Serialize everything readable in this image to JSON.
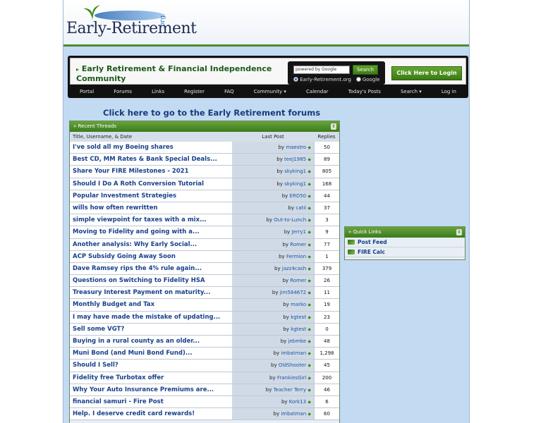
{
  "header": {
    "logo_text": "Early-Retirement",
    "logo_suffix": ".org"
  },
  "site": {
    "title": "Early Retirement & Financial Independence Community",
    "title_arrow": "▸"
  },
  "search": {
    "placeholder": "powered by Google",
    "button_label": "Search",
    "option_site": "Early-Retirement.org",
    "option_google": "Google"
  },
  "login": {
    "label": "Click Here to Login"
  },
  "nav": {
    "items": [
      {
        "label": "Portal"
      },
      {
        "label": "Forums"
      },
      {
        "label": "Links"
      },
      {
        "label": "Register"
      },
      {
        "label": "FAQ"
      },
      {
        "label": "Community ▾"
      },
      {
        "label": "Calendar"
      },
      {
        "label": "Today's Posts"
      },
      {
        "label": "Search ▾"
      },
      {
        "label": "Log in"
      }
    ]
  },
  "forums_link": "Click here to go to the Early Retirement forums",
  "recent_threads": {
    "heading": "» Recent Threads",
    "toggle": "⇕",
    "col_title": "Title, Username, & Date",
    "col_last": "Last Post",
    "col_replies": "Replies",
    "by": "by",
    "rows": [
      {
        "title": "I've sold all my Boeing shares",
        "user": "maestro",
        "replies": "50"
      },
      {
        "title": "Best CD, MM Rates & Bank Special Deals...",
        "user": "teej1985",
        "replies": "89"
      },
      {
        "title": "Share Your FIRE Milestones - 2021",
        "user": "skyking1",
        "replies": "805"
      },
      {
        "title": "Should I Do A Roth Conversion Tutorial",
        "user": "skyking1",
        "replies": "168"
      },
      {
        "title": "Popular Investment Strategies",
        "user": "ERD50",
        "replies": "44"
      },
      {
        "title": "wills how often rewritten",
        "user": "catii",
        "replies": "37"
      },
      {
        "title": "simple viewpoint for taxes with a mix...",
        "user": "Out-to-Lunch",
        "replies": "3"
      },
      {
        "title": "Moving to Fidelity and going with a...",
        "user": "Jerry1",
        "replies": "9"
      },
      {
        "title": "Another analysis: Why Early Social...",
        "user": "Romer",
        "replies": "77"
      },
      {
        "title": "ACP Subsidy Going Away Soon",
        "user": "Fermion",
        "replies": "1"
      },
      {
        "title": "Dave Ramsey rips the 4% rule again...",
        "user": "jazz4cash",
        "replies": "379"
      },
      {
        "title": "Questions on Switching to Fidelity HSA",
        "user": "Romer",
        "replies": "26"
      },
      {
        "title": "Treasury Interest Payment on maturity...",
        "user": "jim584672",
        "replies": "11"
      },
      {
        "title": "Monthly Budget and Tax",
        "user": "marko",
        "replies": "19"
      },
      {
        "title": "I may have made the mistake of updating...",
        "user": "kgtest",
        "replies": "23"
      },
      {
        "title": "Sell some VGT?",
        "user": "kgtest",
        "replies": "0"
      },
      {
        "title": "Buying in a rural county as an older...",
        "user": "jebmke",
        "replies": "48"
      },
      {
        "title": "Muni Bond (and Muni Bond Fund)...",
        "user": "imbatman",
        "replies": "1,298"
      },
      {
        "title": "Should I Sell?",
        "user": "OldShooter",
        "replies": "45"
      },
      {
        "title": "Fidelity free Turbotax offer",
        "user": "FrankiesGirl",
        "replies": "200"
      },
      {
        "title": "Why Your Auto Insurance Premiums are...",
        "user": "Teacher Terry",
        "replies": "46"
      },
      {
        "title": "financial samuri - Fire Post",
        "user": "Kork13",
        "replies": "6"
      },
      {
        "title": "Help. I deserve credit card rewards!",
        "user": "imbatman",
        "replies": "60"
      }
    ]
  },
  "quick_links": {
    "heading": "» Quick Links",
    "toggle": "⇕",
    "items": [
      {
        "label": "Post Feed"
      },
      {
        "label": "FIRE Calc"
      }
    ]
  }
}
